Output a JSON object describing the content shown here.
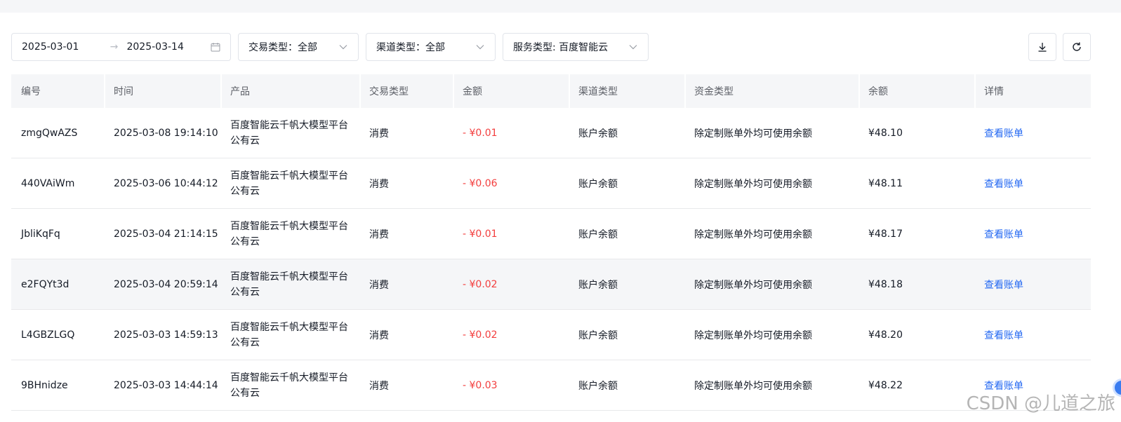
{
  "filters": {
    "date_start": "2025-03-01",
    "date_sep": "→",
    "date_end": "2025-03-14",
    "trade_type": "交易类型：全部",
    "channel_type": "渠道类型：全部",
    "service_type": "服务类型: 百度智能云"
  },
  "icons": {
    "calendar": "calendar-icon",
    "chevron": "chevron-down-icon",
    "download": "download-icon",
    "refresh": "refresh-icon"
  },
  "colors": {
    "amount": "#f33e3e",
    "link": "#2468f2",
    "header_bg": "#f5f6f8"
  },
  "table": {
    "headers": [
      "编号",
      "时间",
      "产品",
      "交易类型",
      "金额",
      "渠道类型",
      "资金类型",
      "余额",
      "详情"
    ],
    "rows": [
      {
        "id": "zmgQwAZS",
        "time": "2025-03-08 19:14:10",
        "product": "百度智能云千帆大模型平台公有云",
        "type": "消费",
        "amount": "- ¥0.01",
        "channel": "账户余额",
        "fund": "除定制账单外均可使用余额",
        "balance": "¥48.10",
        "detail": "查看账单"
      },
      {
        "id": "440VAiWm",
        "time": "2025-03-06 10:44:12",
        "product": "百度智能云千帆大模型平台公有云",
        "type": "消费",
        "amount": "- ¥0.06",
        "channel": "账户余额",
        "fund": "除定制账单外均可使用余额",
        "balance": "¥48.11",
        "detail": "查看账单"
      },
      {
        "id": "JbliKqFq",
        "time": "2025-03-04 21:14:15",
        "product": "百度智能云千帆大模型平台公有云",
        "type": "消费",
        "amount": "- ¥0.01",
        "channel": "账户余额",
        "fund": "除定制账单外均可使用余额",
        "balance": "¥48.17",
        "detail": "查看账单"
      },
      {
        "id": "e2FQYt3d",
        "time": "2025-03-04 20:59:14",
        "product": "百度智能云千帆大模型平台公有云",
        "type": "消费",
        "amount": "- ¥0.02",
        "channel": "账户余额",
        "fund": "除定制账单外均可使用余额",
        "balance": "¥48.18",
        "detail": "查看账单"
      },
      {
        "id": "L4GBZLGQ",
        "time": "2025-03-03 14:59:13",
        "product": "百度智能云千帆大模型平台公有云",
        "type": "消费",
        "amount": "- ¥0.02",
        "channel": "账户余额",
        "fund": "除定制账单外均可使用余额",
        "balance": "¥48.20",
        "detail": "查看账单"
      },
      {
        "id": "9BHnidze",
        "time": "2025-03-03 14:44:14",
        "product": "百度智能云千帆大模型平台公有云",
        "type": "消费",
        "amount": "- ¥0.03",
        "channel": "账户余额",
        "fund": "除定制账单外均可使用余额",
        "balance": "¥48.22",
        "detail": "查看账单"
      }
    ]
  },
  "watermark": "CSDN @儿道之旅"
}
